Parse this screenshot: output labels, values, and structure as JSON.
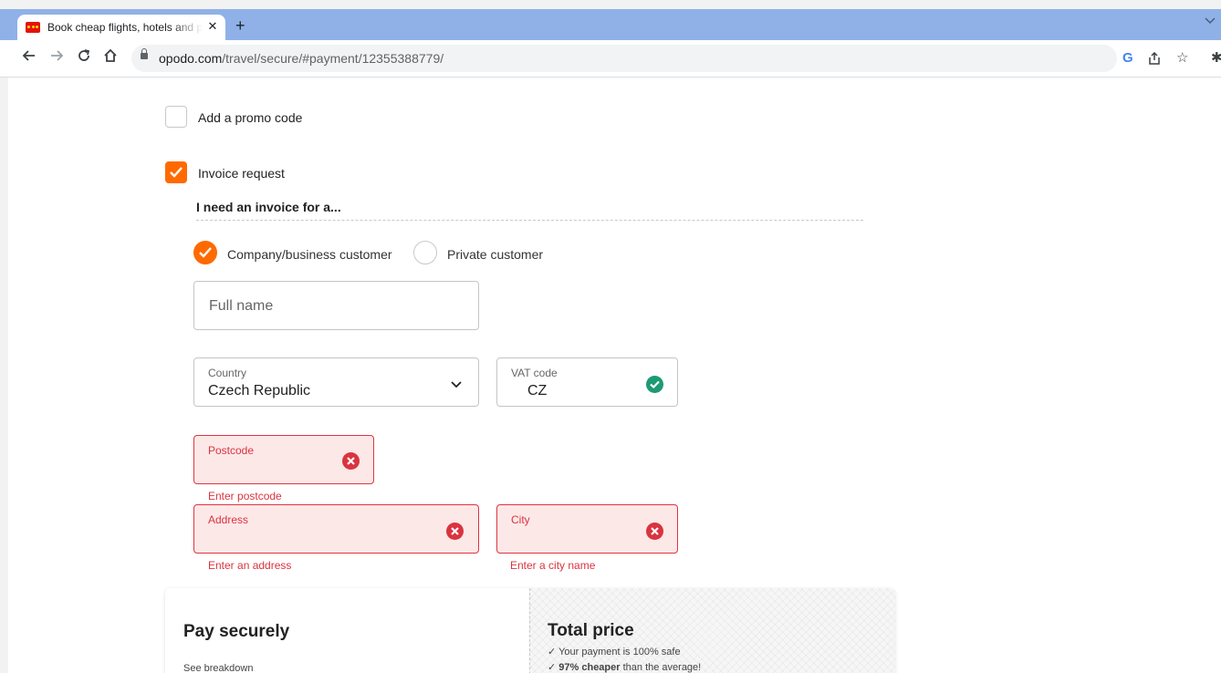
{
  "browser": {
    "tab_title": "Book cheap flights, hotels and pa",
    "tab_close": "✕",
    "new_tab": "+",
    "url_host": "opodo.com",
    "url_path": "/travel/secure/#payment/12355388779/",
    "icons": [
      "back-icon",
      "forward-icon",
      "reload-icon",
      "home-icon",
      "lock-icon",
      "google-icon",
      "share-icon",
      "star-icon",
      "extensions-icon"
    ]
  },
  "form": {
    "promo_label": "Add a promo code",
    "promo_checked": false,
    "invoice_label": "Invoice request",
    "invoice_checked": true,
    "invoice_subheading": "I need an invoice for a...",
    "customer_type": {
      "company_label": "Company/business customer",
      "company_selected": true,
      "private_label": "Private customer",
      "private_selected": false
    },
    "full_name": {
      "placeholder": "Full name",
      "value": ""
    },
    "country": {
      "label": "Country",
      "value": "Czech Republic"
    },
    "vat": {
      "label": "VAT code",
      "value": "CZ",
      "status": "valid"
    },
    "postcode": {
      "label": "Postcode",
      "value": "",
      "error": "Enter postcode"
    },
    "address": {
      "label": "Address",
      "value": "",
      "error": "Enter an address"
    },
    "city": {
      "label": "City",
      "value": "",
      "error": "Enter a city name"
    }
  },
  "summary": {
    "pay_title": "Pay securely",
    "see_breakdown": "See breakdown",
    "total_title": "Total price",
    "safe_note": "✓ Your payment is 100% safe",
    "cheaper_bold": "97% cheaper",
    "cheaper_rest": " than the average!",
    "cheaper_prefix": "✓ "
  },
  "colors": {
    "accent": "#ff6a00",
    "error": "#d9343f",
    "valid": "#1d9a74"
  }
}
